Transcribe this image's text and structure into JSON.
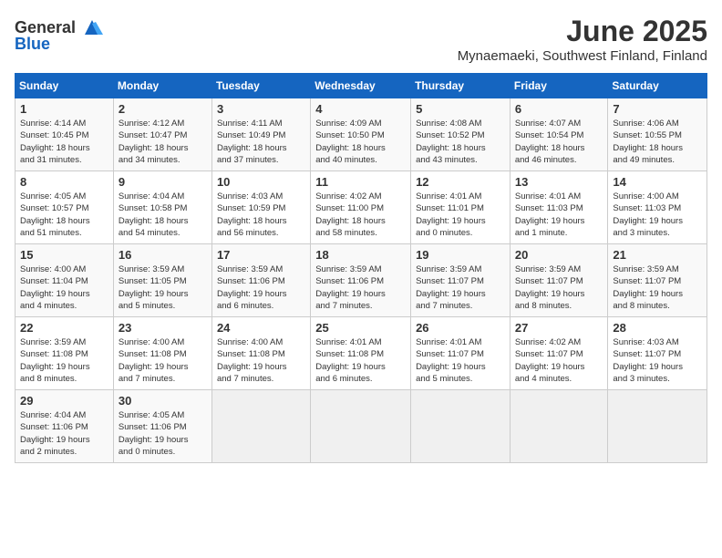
{
  "header": {
    "logo_general": "General",
    "logo_blue": "Blue",
    "month": "June 2025",
    "location": "Mynaemaeki, Southwest Finland, Finland"
  },
  "days_of_week": [
    "Sunday",
    "Monday",
    "Tuesday",
    "Wednesday",
    "Thursday",
    "Friday",
    "Saturday"
  ],
  "weeks": [
    [
      {
        "day": "1",
        "info": "Sunrise: 4:14 AM\nSunset: 10:45 PM\nDaylight: 18 hours\nand 31 minutes."
      },
      {
        "day": "2",
        "info": "Sunrise: 4:12 AM\nSunset: 10:47 PM\nDaylight: 18 hours\nand 34 minutes."
      },
      {
        "day": "3",
        "info": "Sunrise: 4:11 AM\nSunset: 10:49 PM\nDaylight: 18 hours\nand 37 minutes."
      },
      {
        "day": "4",
        "info": "Sunrise: 4:09 AM\nSunset: 10:50 PM\nDaylight: 18 hours\nand 40 minutes."
      },
      {
        "day": "5",
        "info": "Sunrise: 4:08 AM\nSunset: 10:52 PM\nDaylight: 18 hours\nand 43 minutes."
      },
      {
        "day": "6",
        "info": "Sunrise: 4:07 AM\nSunset: 10:54 PM\nDaylight: 18 hours\nand 46 minutes."
      },
      {
        "day": "7",
        "info": "Sunrise: 4:06 AM\nSunset: 10:55 PM\nDaylight: 18 hours\nand 49 minutes."
      }
    ],
    [
      {
        "day": "8",
        "info": "Sunrise: 4:05 AM\nSunset: 10:57 PM\nDaylight: 18 hours\nand 51 minutes."
      },
      {
        "day": "9",
        "info": "Sunrise: 4:04 AM\nSunset: 10:58 PM\nDaylight: 18 hours\nand 54 minutes."
      },
      {
        "day": "10",
        "info": "Sunrise: 4:03 AM\nSunset: 10:59 PM\nDaylight: 18 hours\nand 56 minutes."
      },
      {
        "day": "11",
        "info": "Sunrise: 4:02 AM\nSunset: 11:00 PM\nDaylight: 18 hours\nand 58 minutes."
      },
      {
        "day": "12",
        "info": "Sunrise: 4:01 AM\nSunset: 11:01 PM\nDaylight: 19 hours\nand 0 minutes."
      },
      {
        "day": "13",
        "info": "Sunrise: 4:01 AM\nSunset: 11:03 PM\nDaylight: 19 hours\nand 1 minute."
      },
      {
        "day": "14",
        "info": "Sunrise: 4:00 AM\nSunset: 11:03 PM\nDaylight: 19 hours\nand 3 minutes."
      }
    ],
    [
      {
        "day": "15",
        "info": "Sunrise: 4:00 AM\nSunset: 11:04 PM\nDaylight: 19 hours\nand 4 minutes."
      },
      {
        "day": "16",
        "info": "Sunrise: 3:59 AM\nSunset: 11:05 PM\nDaylight: 19 hours\nand 5 minutes."
      },
      {
        "day": "17",
        "info": "Sunrise: 3:59 AM\nSunset: 11:06 PM\nDaylight: 19 hours\nand 6 minutes."
      },
      {
        "day": "18",
        "info": "Sunrise: 3:59 AM\nSunset: 11:06 PM\nDaylight: 19 hours\nand 7 minutes."
      },
      {
        "day": "19",
        "info": "Sunrise: 3:59 AM\nSunset: 11:07 PM\nDaylight: 19 hours\nand 7 minutes."
      },
      {
        "day": "20",
        "info": "Sunrise: 3:59 AM\nSunset: 11:07 PM\nDaylight: 19 hours\nand 8 minutes."
      },
      {
        "day": "21",
        "info": "Sunrise: 3:59 AM\nSunset: 11:07 PM\nDaylight: 19 hours\nand 8 minutes."
      }
    ],
    [
      {
        "day": "22",
        "info": "Sunrise: 3:59 AM\nSunset: 11:08 PM\nDaylight: 19 hours\nand 8 minutes."
      },
      {
        "day": "23",
        "info": "Sunrise: 4:00 AM\nSunset: 11:08 PM\nDaylight: 19 hours\nand 7 minutes."
      },
      {
        "day": "24",
        "info": "Sunrise: 4:00 AM\nSunset: 11:08 PM\nDaylight: 19 hours\nand 7 minutes."
      },
      {
        "day": "25",
        "info": "Sunrise: 4:01 AM\nSunset: 11:08 PM\nDaylight: 19 hours\nand 6 minutes."
      },
      {
        "day": "26",
        "info": "Sunrise: 4:01 AM\nSunset: 11:07 PM\nDaylight: 19 hours\nand 5 minutes."
      },
      {
        "day": "27",
        "info": "Sunrise: 4:02 AM\nSunset: 11:07 PM\nDaylight: 19 hours\nand 4 minutes."
      },
      {
        "day": "28",
        "info": "Sunrise: 4:03 AM\nSunset: 11:07 PM\nDaylight: 19 hours\nand 3 minutes."
      }
    ],
    [
      {
        "day": "29",
        "info": "Sunrise: 4:04 AM\nSunset: 11:06 PM\nDaylight: 19 hours\nand 2 minutes."
      },
      {
        "day": "30",
        "info": "Sunrise: 4:05 AM\nSunset: 11:06 PM\nDaylight: 19 hours\nand 0 minutes."
      },
      {
        "day": "",
        "info": ""
      },
      {
        "day": "",
        "info": ""
      },
      {
        "day": "",
        "info": ""
      },
      {
        "day": "",
        "info": ""
      },
      {
        "day": "",
        "info": ""
      }
    ]
  ]
}
